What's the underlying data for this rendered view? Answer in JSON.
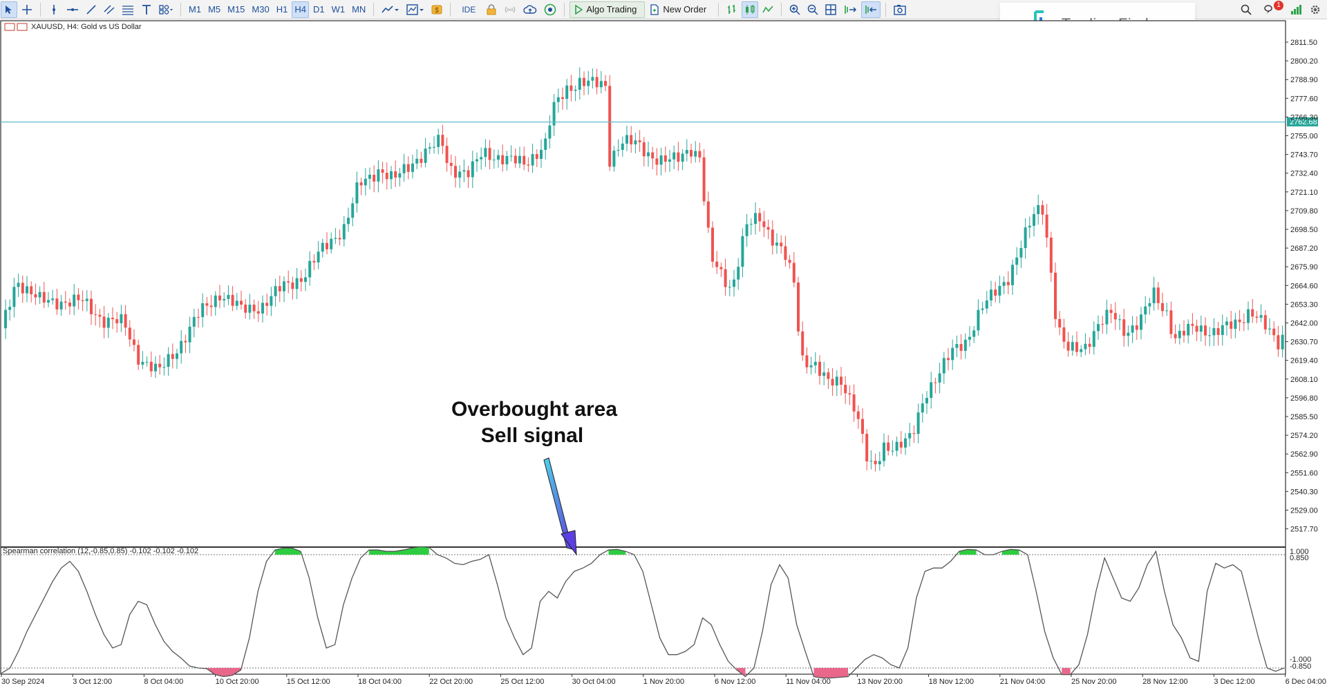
{
  "toolbar": {
    "timeframes": [
      "M1",
      "M5",
      "M15",
      "M30",
      "H1",
      "H4",
      "D1",
      "W1",
      "MN"
    ],
    "active_timeframe": "H4",
    "ide_label": "IDE",
    "algo_trading_label": "Algo Trading",
    "new_order_label": "New Order",
    "notification_count": "1"
  },
  "logo": {
    "text": "Trading Finder"
  },
  "chart": {
    "symbol_label": "XAUUSD, H4:  Gold vs US Dollar",
    "current_price": "2762.68",
    "horizontal_line_price": 2763.3,
    "price_axis_labels": [
      "2811.50",
      "2800.20",
      "2788.90",
      "2777.60",
      "2766.30",
      "2755.00",
      "2743.70",
      "2732.40",
      "2721.10",
      "2709.80",
      "2698.50",
      "2687.20",
      "2675.90",
      "2664.60",
      "2653.30",
      "2642.00",
      "2630.70",
      "2619.40",
      "2608.10",
      "2596.80",
      "2585.50",
      "2574.20",
      "2562.90",
      "2551.60",
      "2540.30",
      "2529.00",
      "2517.70"
    ],
    "time_axis_labels": [
      "30 Sep 2024",
      "3 Oct 12:00",
      "8 Oct 04:00",
      "10 Oct 20:00",
      "15 Oct 12:00",
      "18 Oct 04:00",
      "22 Oct 20:00",
      "25 Oct 12:00",
      "30 Oct 04:00",
      "1 Nov 20:00",
      "6 Nov 12:00",
      "11 Nov 04:00",
      "13 Nov 20:00",
      "18 Nov 12:00",
      "21 Nov 04:00",
      "25 Nov 20:00",
      "28 Nov 12:00",
      "3 Dec 12:00",
      "6 Dec 04:00"
    ],
    "colors": {
      "bull": "#26a69a",
      "bear": "#ef5350",
      "hline": "#5fb9c9",
      "ind_line": "#555555",
      "overbought_fill": "#2ecc40",
      "oversold_fill": "#e8678a"
    }
  },
  "indicator": {
    "label": "Spearman correlation (12,-0.85,0.85) -0.102 -0.102 -0.102",
    "axis_labels": [
      "1.000",
      "0.850",
      "-1.000",
      "-0.850"
    ],
    "upper_level": 0.85,
    "lower_level": -0.85
  },
  "annotation": {
    "line1": "Overbought area",
    "line2": "Sell signal"
  },
  "chart_data": {
    "type": "line",
    "series": [
      {
        "name": "Spearman correlation",
        "y": [
          -0.93,
          -0.85,
          -0.6,
          -0.3,
          -0.05,
          0.2,
          0.45,
          0.65,
          0.75,
          0.6,
          0.3,
          -0.05,
          -0.35,
          -0.55,
          -0.5,
          -0.05,
          0.15,
          0.1,
          -0.2,
          -0.45,
          -0.6,
          -0.7,
          -0.82,
          -0.85,
          -0.86,
          -0.95,
          -0.98,
          -0.96,
          -0.88,
          -0.4,
          0.3,
          0.75,
          0.92,
          0.95,
          0.95,
          0.9,
          0.5,
          -0.1,
          -0.55,
          -0.5,
          0.1,
          0.5,
          0.8,
          0.92,
          0.92,
          0.9,
          0.9,
          0.92,
          0.95,
          0.97,
          0.96,
          0.85,
          0.8,
          0.72,
          0.7,
          0.75,
          0.78,
          0.85,
          0.4,
          -0.1,
          -0.4,
          -0.65,
          -0.55,
          0.15,
          0.3,
          0.2,
          0.45,
          0.6,
          0.65,
          0.72,
          0.85,
          0.92,
          0.93,
          0.9,
          0.85,
          0.6,
          0.1,
          -0.4,
          -0.65,
          -0.65,
          -0.6,
          -0.5,
          -0.1,
          -0.2,
          -0.5,
          -0.75,
          -0.88,
          -0.98,
          -0.85,
          -0.3,
          0.4,
          0.7,
          0.5,
          -0.2,
          -0.6,
          -0.98,
          -1.0,
          -1.0,
          -0.99,
          -0.98,
          -0.85,
          -0.72,
          -0.65,
          -0.7,
          -0.8,
          -0.85,
          -0.55,
          0.2,
          0.6,
          0.65,
          0.65,
          0.75,
          0.9,
          0.93,
          0.92,
          0.85,
          0.85,
          0.9,
          0.93,
          0.92,
          0.85,
          0.3,
          -0.3,
          -0.7,
          -0.95,
          -0.95,
          -0.8,
          -0.35,
          0.3,
          0.8,
          0.5,
          0.2,
          0.15,
          0.35,
          0.7,
          0.9,
          0.3,
          -0.2,
          -0.4,
          -0.7,
          -0.75,
          0.3,
          0.72,
          0.65,
          0.7,
          0.6,
          0.1,
          -0.4,
          -0.85,
          -0.9,
          -0.85
        ]
      }
    ]
  }
}
